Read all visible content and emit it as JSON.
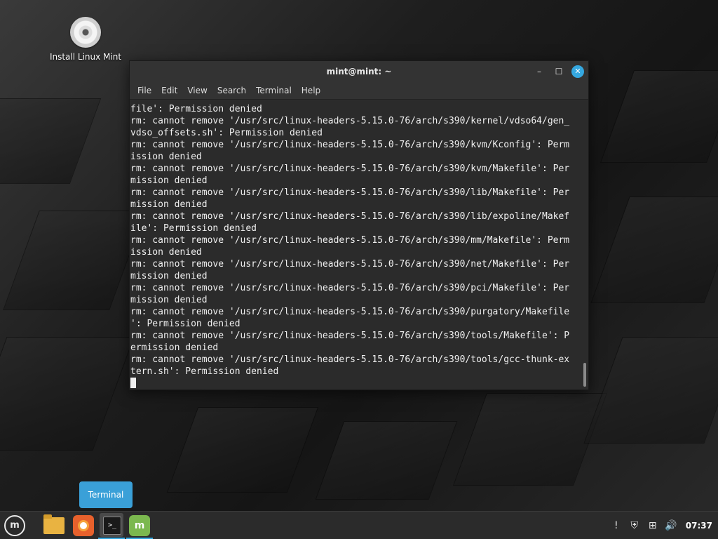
{
  "desktop": {
    "icons": [
      {
        "label": "Install Linux Mint",
        "icon": "disc-icon"
      }
    ]
  },
  "terminal": {
    "title": "mint@mint: ~",
    "controls": {
      "minimize": "–",
      "maximize": "☐",
      "close": "✕"
    },
    "menu": [
      "File",
      "Edit",
      "View",
      "Search",
      "Terminal",
      "Help"
    ],
    "output": [
      "file': Permission denied",
      "rm: cannot remove '/usr/src/linux-headers-5.15.0-76/arch/s390/kernel/vdso64/gen_",
      "vdso_offsets.sh': Permission denied",
      "rm: cannot remove '/usr/src/linux-headers-5.15.0-76/arch/s390/kvm/Kconfig': Perm",
      "ission denied",
      "rm: cannot remove '/usr/src/linux-headers-5.15.0-76/arch/s390/kvm/Makefile': Per",
      "mission denied",
      "rm: cannot remove '/usr/src/linux-headers-5.15.0-76/arch/s390/lib/Makefile': Per",
      "mission denied",
      "rm: cannot remove '/usr/src/linux-headers-5.15.0-76/arch/s390/lib/expoline/Makef",
      "ile': Permission denied",
      "rm: cannot remove '/usr/src/linux-headers-5.15.0-76/arch/s390/mm/Makefile': Perm",
      "ission denied",
      "rm: cannot remove '/usr/src/linux-headers-5.15.0-76/arch/s390/net/Makefile': Per",
      "mission denied",
      "rm: cannot remove '/usr/src/linux-headers-5.15.0-76/arch/s390/pci/Makefile': Per",
      "mission denied",
      "rm: cannot remove '/usr/src/linux-headers-5.15.0-76/arch/s390/purgatory/Makefile",
      "': Permission denied",
      "rm: cannot remove '/usr/src/linux-headers-5.15.0-76/arch/s390/tools/Makefile': P",
      "ermission denied",
      "rm: cannot remove '/usr/src/linux-headers-5.15.0-76/arch/s390/tools/gcc-thunk-ex",
      "tern.sh': Permission denied"
    ]
  },
  "tooltip": {
    "text": "Terminal"
  },
  "panel": {
    "menu_glyph": "m",
    "terminal_glyph": ">_",
    "mint_glyph": "m",
    "tray": {
      "notification": "!",
      "shield": "⛨",
      "network": "⊞",
      "volume": "🔊"
    },
    "clock": "07:37"
  },
  "colors": {
    "accent": "#35a8e0",
    "terminal_bg": "#2b2b2b",
    "panel_bg": "#2b2b2b"
  }
}
